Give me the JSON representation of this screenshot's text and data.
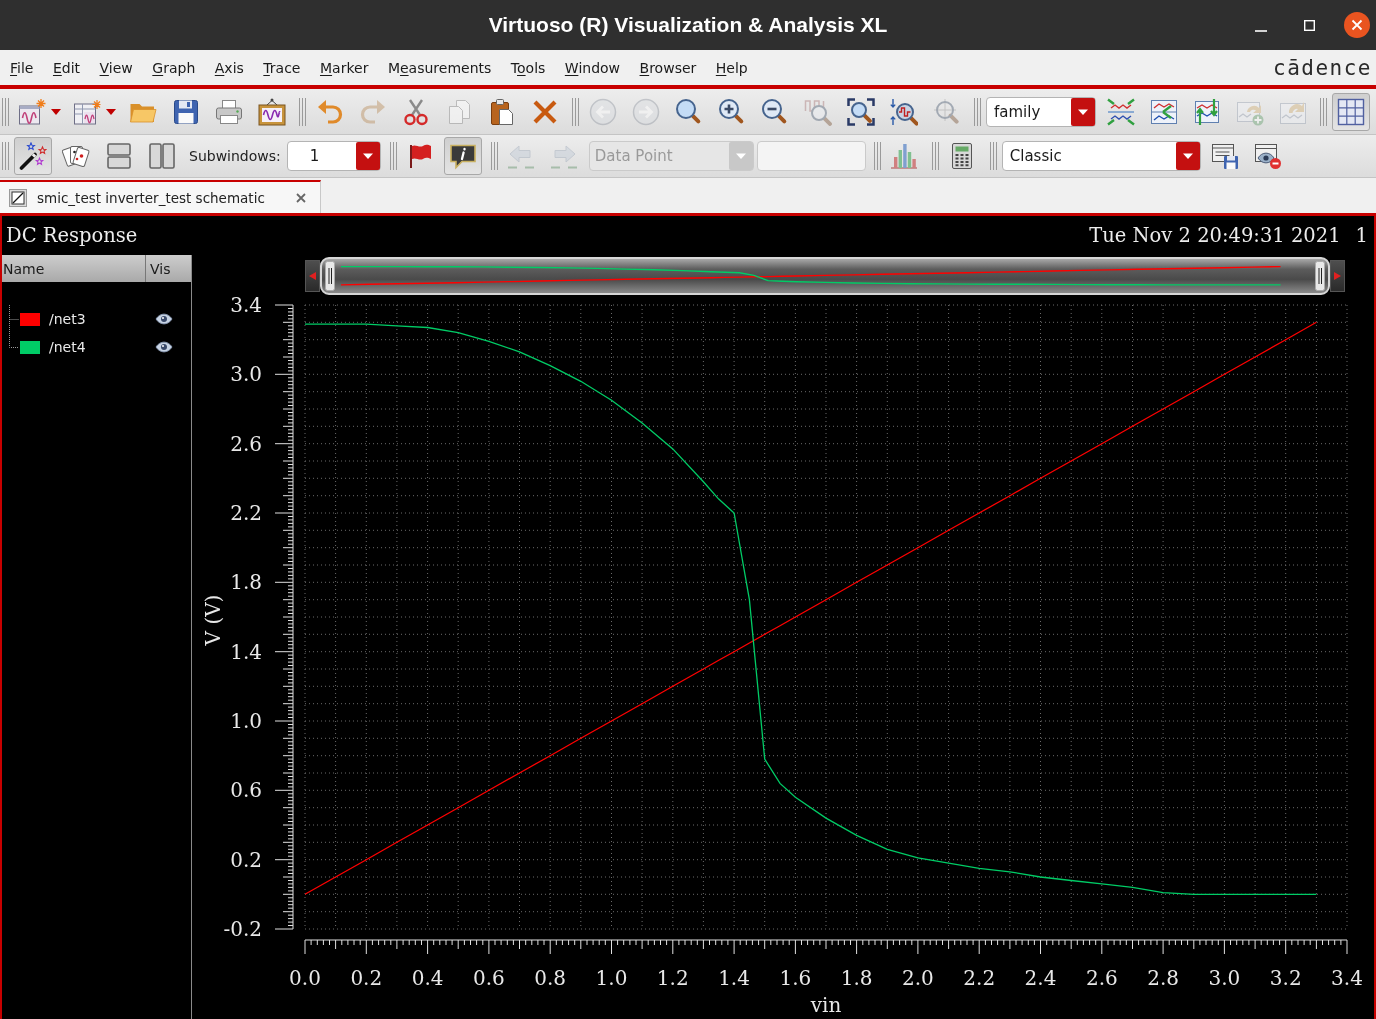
{
  "window": {
    "title": "Virtuoso (R) Visualization & Analysis XL"
  },
  "menu_bar": {
    "items": [
      {
        "parts": [
          {
            "text": "F",
            "underlined": true
          },
          {
            "text": "ile",
            "underlined": false
          }
        ]
      },
      {
        "parts": [
          {
            "text": "E",
            "underlined": true
          },
          {
            "text": "dit",
            "underlined": false
          }
        ]
      },
      {
        "parts": [
          {
            "text": "V",
            "underlined": true
          },
          {
            "text": "iew",
            "underlined": false
          }
        ]
      },
      {
        "parts": [
          {
            "text": "G",
            "underlined": true
          },
          {
            "text": "raph",
            "underlined": false
          }
        ]
      },
      {
        "parts": [
          {
            "text": "A",
            "underlined": true
          },
          {
            "text": "xis",
            "underlined": false
          }
        ]
      },
      {
        "parts": [
          {
            "text": "T",
            "underlined": true
          },
          {
            "text": "race",
            "underlined": false
          }
        ]
      },
      {
        "parts": [
          {
            "text": "M",
            "underlined": true
          },
          {
            "text": "arker",
            "underlined": false
          }
        ]
      },
      {
        "parts": [
          {
            "text": "M",
            "underlined": false
          },
          {
            "text": "e",
            "underlined": true
          },
          {
            "text": "asurements",
            "underlined": false
          }
        ]
      },
      {
        "parts": [
          {
            "text": "T",
            "underlined": false
          },
          {
            "text": "o",
            "underlined": true
          },
          {
            "text": "ols",
            "underlined": false
          }
        ]
      },
      {
        "parts": [
          {
            "text": "W",
            "underlined": true
          },
          {
            "text": "indow",
            "underlined": false
          }
        ]
      },
      {
        "parts": [
          {
            "text": "B",
            "underlined": true
          },
          {
            "text": "rowser",
            "underlined": false
          }
        ]
      },
      {
        "parts": [
          {
            "text": "H",
            "underlined": true
          },
          {
            "text": "elp",
            "underlined": false
          }
        ]
      }
    ],
    "logo": "cādence"
  },
  "toolbars": [
    {
      "groups": [
        {
          "items": [
            {
              "kind": "menu_button",
              "disabled": false,
              "on": false
            },
            {
              "kind": "menu_button",
              "disabled": false,
              "on": false
            },
            {
              "kind": "button",
              "disabled": false,
              "on": false
            },
            {
              "kind": "button",
              "disabled": false,
              "on": false
            },
            {
              "kind": "button",
              "disabled": false,
              "on": false
            },
            {
              "kind": "button",
              "disabled": false,
              "on": false
            }
          ]
        },
        {
          "items": [
            {
              "kind": "button",
              "disabled": false,
              "on": false
            },
            {
              "kind": "button",
              "disabled": true,
              "on": false
            },
            {
              "kind": "button",
              "disabled": false,
              "on": false
            },
            {
              "kind": "button",
              "disabled": true,
              "on": false
            },
            {
              "kind": "button",
              "disabled": false,
              "on": false
            },
            {
              "kind": "button",
              "disabled": false,
              "on": false
            }
          ]
        },
        {
          "items": [
            {
              "kind": "button",
              "disabled": true,
              "on": false
            },
            {
              "kind": "button",
              "disabled": true,
              "on": false
            },
            {
              "kind": "button",
              "disabled": false,
              "on": false
            },
            {
              "kind": "button",
              "disabled": false,
              "on": false
            },
            {
              "kind": "button",
              "disabled": false,
              "on": false
            },
            {
              "kind": "button",
              "disabled": true,
              "on": false
            },
            {
              "kind": "button",
              "disabled": false,
              "on": false
            },
            {
              "kind": "button",
              "disabled": false,
              "on": false
            },
            {
              "kind": "button",
              "disabled": true,
              "on": false
            }
          ]
        },
        {
          "items": [
            {
              "kind": "combo",
              "value": "family",
              "disabled": false
            },
            {
              "kind": "button",
              "disabled": false,
              "on": false
            },
            {
              "kind": "button",
              "disabled": false,
              "on": false
            },
            {
              "kind": "button",
              "disabled": false,
              "on": false
            },
            {
              "kind": "button",
              "disabled": true,
              "on": false
            },
            {
              "kind": "button",
              "disabled": true,
              "on": false
            }
          ]
        },
        {
          "items": [
            {
              "kind": "button",
              "disabled": false,
              "on": true
            }
          ]
        }
      ]
    },
    {
      "groups": [
        {
          "items": [
            {
              "kind": "button",
              "disabled": false,
              "on": true
            },
            {
              "kind": "button",
              "disabled": false,
              "on": false
            },
            {
              "kind": "button",
              "disabled": false,
              "on": false
            },
            {
              "kind": "button",
              "disabled": false,
              "on": false
            },
            {
              "kind": "label",
              "text": "Subwindows:"
            },
            {
              "kind": "combo",
              "value": "1",
              "disabled": false
            }
          ]
        },
        {
          "items": [
            {
              "kind": "button",
              "disabled": false,
              "on": false
            },
            {
              "kind": "button",
              "disabled": false,
              "on": true
            }
          ]
        },
        {
          "items": [
            {
              "kind": "button",
              "disabled": true,
              "on": false
            },
            {
              "kind": "button",
              "disabled": true,
              "on": false
            },
            {
              "kind": "combo",
              "value": "Data Point",
              "disabled": true
            },
            {
              "kind": "field",
              "disabled": true
            }
          ]
        },
        {
          "items": [
            {
              "kind": "button",
              "disabled": false,
              "on": false
            }
          ]
        },
        {
          "items": [
            {
              "kind": "button",
              "disabled": false,
              "on": false
            }
          ]
        },
        {
          "items": [
            {
              "kind": "combo",
              "value": "Classic",
              "disabled": false
            },
            {
              "kind": "button",
              "disabled": false,
              "on": false
            },
            {
              "kind": "button",
              "disabled": false,
              "on": false
            }
          ]
        }
      ]
    }
  ],
  "tabs": [
    {
      "label": "smic_test inverter_test schematic",
      "selected": true
    }
  ],
  "plot": {
    "title": "DC Response",
    "timestamp": "Tue Nov 2 20:49:31 2021",
    "subwindow": "1",
    "signal_list": {
      "columns": [
        "Name",
        "Vis"
      ],
      "items": [
        {
          "name": "/net3",
          "color": "#ff0000",
          "visible": true
        },
        {
          "name": "/net4",
          "color": "#00cc66",
          "visible": true
        }
      ]
    },
    "chart_data": {
      "type": "line",
      "xlabel": "vin",
      "ylabel": "V (V)",
      "xlim": [
        0,
        3.4
      ],
      "ylim": [
        -0.2,
        3.4
      ],
      "xticks": [
        {
          "value": 0,
          "label": "0.0"
        },
        {
          "value": 0.2,
          "label": "0.2"
        },
        {
          "value": 0.4,
          "label": "0.4"
        },
        {
          "value": 0.6,
          "label": "0.6"
        },
        {
          "value": 0.8,
          "label": "0.8"
        },
        {
          "value": 1,
          "label": "1.0"
        },
        {
          "value": 1.2,
          "label": "1.2"
        },
        {
          "value": 1.4,
          "label": "1.4"
        },
        {
          "value": 1.6,
          "label": "1.6"
        },
        {
          "value": 1.8,
          "label": "1.8"
        },
        {
          "value": 2,
          "label": "2.0"
        },
        {
          "value": 2.2,
          "label": "2.2"
        },
        {
          "value": 2.4,
          "label": "2.4"
        },
        {
          "value": 2.6,
          "label": "2.6"
        },
        {
          "value": 2.8,
          "label": "2.8"
        },
        {
          "value": 3,
          "label": "3.0"
        },
        {
          "value": 3.2,
          "label": "3.2"
        },
        {
          "value": 3.4,
          "label": "3.4"
        }
      ],
      "yticks": [
        {
          "value": -0.2,
          "label": "-0.2"
        },
        {
          "value": 0.2,
          "label": "0.2"
        },
        {
          "value": 0.6,
          "label": "0.6"
        },
        {
          "value": 1,
          "label": "1.0"
        },
        {
          "value": 1.4,
          "label": "1.4"
        },
        {
          "value": 1.8,
          "label": "1.8"
        },
        {
          "value": 2.2,
          "label": "2.2"
        },
        {
          "value": 2.6,
          "label": "2.6"
        },
        {
          "value": 3,
          "label": "3.0"
        },
        {
          "value": 3.4,
          "label": "3.4"
        }
      ],
      "grid": true,
      "x": [
        0,
        0.1,
        0.2,
        0.3,
        0.4,
        0.5,
        0.6,
        0.7,
        0.8,
        0.9,
        1.0,
        1.1,
        1.2,
        1.3,
        1.35,
        1.4,
        1.45,
        1.5,
        1.55,
        1.6,
        1.7,
        1.8,
        1.9,
        2.0,
        2.1,
        2.2,
        2.3,
        2.4,
        2.5,
        2.6,
        2.7,
        2.8,
        2.9,
        3.0,
        3.1,
        3.2,
        3.3
      ],
      "series": [
        {
          "color": "#ff0000",
          "values": [
            0,
            0.1,
            0.2,
            0.3,
            0.4,
            0.5,
            0.6,
            0.7,
            0.8,
            0.9,
            1.0,
            1.1,
            1.2,
            1.3,
            1.35,
            1.4,
            1.45,
            1.5,
            1.55,
            1.6,
            1.7,
            1.8,
            1.9,
            2.0,
            2.1,
            2.2,
            2.3,
            2.4,
            2.5,
            2.6,
            2.7,
            2.8,
            2.9,
            3.0,
            3.1,
            3.2,
            3.3
          ]
        },
        {
          "color": "#00cc66",
          "values": [
            3.29,
            3.29,
            3.29,
            3.28,
            3.27,
            3.24,
            3.19,
            3.13,
            3.05,
            2.96,
            2.85,
            2.72,
            2.57,
            2.38,
            2.28,
            2.2,
            1.7,
            0.78,
            0.64,
            0.56,
            0.44,
            0.34,
            0.26,
            0.21,
            0.18,
            0.15,
            0.13,
            0.1,
            0.08,
            0.06,
            0.04,
            0.01,
            0,
            0,
            0,
            0,
            0
          ]
        }
      ]
    }
  }
}
